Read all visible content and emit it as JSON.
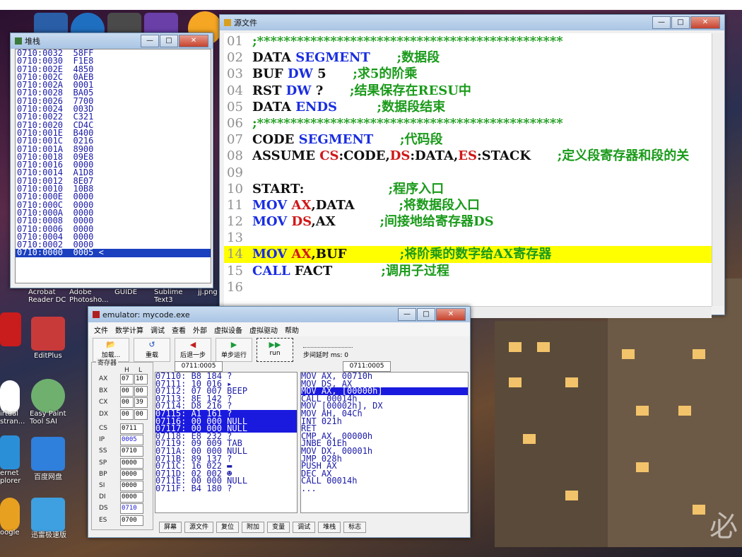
{
  "desktop": {
    "icons": [
      {
        "label": "Acrobat Reader DC",
        "lines": [
          "Acrobat",
          "Reader DC"
        ]
      },
      {
        "label": "Adobe Photoshop",
        "lines": [
          "Adobe",
          "Photosho..."
        ]
      },
      {
        "label": "GUIDE",
        "lines": [
          "GUIDE"
        ]
      },
      {
        "label": "Sublime Text3",
        "lines": [
          "Sublime",
          "Text3"
        ]
      },
      {
        "label": "jj.png",
        "lines": [
          "jj.png"
        ]
      },
      {
        "label": "EditPlus",
        "lines": [
          "EditPlus"
        ]
      },
      {
        "label": "Easy Paint Tool SAI",
        "lines": [
          "Easy Paint",
          "Tool SAI"
        ]
      },
      {
        "label": "百度网盘",
        "lines": [
          "百度网盘"
        ]
      },
      {
        "label": "迅雷极速版",
        "lines": [
          "迅雷极速版"
        ]
      },
      {
        "label": "Internet Explorer",
        "lines": [
          "ernet",
          "plorer"
        ]
      },
      {
        "label": "Google",
        "lines": [
          "oogle"
        ]
      },
      {
        "label": "Virtual",
        "lines": [
          "irtual",
          "stran..."
        ]
      }
    ],
    "watermark": "必"
  },
  "stack_window": {
    "title": "堆栈",
    "rows": [
      {
        "addr": "0710:0032",
        "val": "58FF"
      },
      {
        "addr": "0710:0030",
        "val": "F1E8"
      },
      {
        "addr": "0710:002E",
        "val": "4850"
      },
      {
        "addr": "0710:002C",
        "val": "0AEB"
      },
      {
        "addr": "0710:002A",
        "val": "0001"
      },
      {
        "addr": "0710:0028",
        "val": "BA05"
      },
      {
        "addr": "0710:0026",
        "val": "7700"
      },
      {
        "addr": "0710:0024",
        "val": "003D"
      },
      {
        "addr": "0710:0022",
        "val": "C321"
      },
      {
        "addr": "0710:0020",
        "val": "CD4C"
      },
      {
        "addr": "0710:001E",
        "val": "B400"
      },
      {
        "addr": "0710:001C",
        "val": "0216"
      },
      {
        "addr": "0710:001A",
        "val": "8900"
      },
      {
        "addr": "0710:0018",
        "val": "09E8"
      },
      {
        "addr": "0710:0016",
        "val": "0000"
      },
      {
        "addr": "0710:0014",
        "val": "A1D8"
      },
      {
        "addr": "0710:0012",
        "val": "8E07"
      },
      {
        "addr": "0710:0010",
        "val": "10B8"
      },
      {
        "addr": "0710:000E",
        "val": "0000"
      },
      {
        "addr": "0710:000C",
        "val": "0000"
      },
      {
        "addr": "0710:000A",
        "val": "0000"
      },
      {
        "addr": "0710:0008",
        "val": "0000"
      },
      {
        "addr": "0710:0006",
        "val": "0000"
      },
      {
        "addr": "0710:0004",
        "val": "0000"
      },
      {
        "addr": "0710:0002",
        "val": "0000"
      },
      {
        "addr": "0710:0000",
        "val": "0005 <",
        "selected": true
      }
    ]
  },
  "source_window": {
    "title": "源文件",
    "lines": [
      {
        "n": "01",
        "parts": [
          [
            "cmt",
            ";**********************************************"
          ]
        ]
      },
      {
        "n": "02",
        "parts": [
          [
            "txt",
            "DATA "
          ],
          [
            "kw",
            "SEGMENT"
          ],
          [
            "txt",
            "      "
          ],
          [
            "cmt",
            ";数据段"
          ]
        ]
      },
      {
        "n": "03",
        "parts": [
          [
            "txt",
            "BUF "
          ],
          [
            "kw",
            "DW"
          ],
          [
            "txt",
            " 5      "
          ],
          [
            "cmt",
            ";求5的阶乘"
          ]
        ]
      },
      {
        "n": "04",
        "parts": [
          [
            "txt",
            "RST "
          ],
          [
            "kw",
            "DW"
          ],
          [
            "txt",
            " ?      "
          ],
          [
            "cmt",
            ";结果保存在RESU中"
          ]
        ]
      },
      {
        "n": "05",
        "parts": [
          [
            "txt",
            "DATA "
          ],
          [
            "kw",
            "ENDS"
          ],
          [
            "txt",
            "         "
          ],
          [
            "cmt",
            ";数据段结束"
          ]
        ]
      },
      {
        "n": "06",
        "parts": [
          [
            "cmt",
            ";**********************************************"
          ]
        ]
      },
      {
        "n": "07",
        "parts": [
          [
            "txt",
            "CODE "
          ],
          [
            "kw",
            "SEGMENT"
          ],
          [
            "txt",
            "      "
          ],
          [
            "cmt",
            ";代码段"
          ]
        ]
      },
      {
        "n": "08",
        "parts": [
          [
            "kw",
            ""
          ],
          [
            "txt",
            "ASSUME "
          ],
          [
            "reg",
            "CS"
          ],
          [
            "txt",
            ":CODE,"
          ],
          [
            "reg",
            "DS"
          ],
          [
            "txt",
            ":DATA,"
          ],
          [
            "reg",
            "ES"
          ],
          [
            "txt",
            ":STACK      "
          ],
          [
            "cmt",
            ";定义段寄存器和段的关"
          ]
        ]
      },
      {
        "n": "09",
        "parts": []
      },
      {
        "n": "10",
        "parts": [
          [
            "txt",
            "START:                   "
          ],
          [
            "cmt",
            ";程序入口"
          ]
        ]
      },
      {
        "n": "11",
        "parts": [
          [
            "kw",
            "MOV "
          ],
          [
            "reg",
            "AX"
          ],
          [
            "txt",
            ",DATA          "
          ],
          [
            "cmt",
            ";将数据段入口"
          ]
        ]
      },
      {
        "n": "12",
        "parts": [
          [
            "kw",
            "MOV "
          ],
          [
            "reg",
            "DS"
          ],
          [
            "txt",
            ",AX          "
          ],
          [
            "cmt",
            ";间接地给寄存器DS"
          ]
        ]
      },
      {
        "n": "13",
        "parts": []
      },
      {
        "n": "14",
        "hl": true,
        "parts": [
          [
            "kw",
            "MOV "
          ],
          [
            "reg",
            "AX"
          ],
          [
            "txt",
            ",BUF            "
          ],
          [
            "cmt",
            ";将阶乘的数字给AX寄存器"
          ]
        ]
      },
      {
        "n": "15",
        "parts": [
          [
            "kw",
            "CALL "
          ],
          [
            "txt",
            "FACT           "
          ],
          [
            "cmt",
            ";调用子过程"
          ]
        ]
      },
      {
        "n": "16",
        "parts": []
      }
    ]
  },
  "emulator": {
    "title": "emulator: mycode.exe",
    "menu": [
      "文件",
      "数学计算",
      "调试",
      "查看",
      "外部",
      "虚拟设备",
      "虚拟驱动",
      "帮助"
    ],
    "toolbar": [
      {
        "label": "加载...",
        "icon": "folder-icon"
      },
      {
        "label": "重载",
        "icon": "reload-icon"
      },
      {
        "label": "后退一步",
        "icon": "step-back-icon"
      },
      {
        "label": "单步运行",
        "icon": "step-forward-icon"
      },
      {
        "label": "run",
        "icon": "run-icon"
      }
    ],
    "step_delay_label": "步间延时 ms: 0",
    "registers_label": "寄存器",
    "hl_headers": [
      "H",
      "L"
    ],
    "regs_hl": [
      {
        "name": "AX",
        "h": "07",
        "l": "10"
      },
      {
        "name": "BX",
        "h": "00",
        "l": "00"
      },
      {
        "name": "CX",
        "h": "00",
        "l": "39"
      },
      {
        "name": "DX",
        "h": "00",
        "l": "00"
      }
    ],
    "regs": [
      {
        "name": "CS",
        "val": "0711"
      },
      {
        "name": "IP",
        "val": "0005"
      },
      {
        "name": "SS",
        "val": "0710"
      },
      {
        "name": "SP",
        "val": "0000"
      },
      {
        "name": "BP",
        "val": "0000"
      },
      {
        "name": "SI",
        "val": "0000"
      },
      {
        "name": "DI",
        "val": "0000"
      },
      {
        "name": "DS",
        "val": "0710"
      },
      {
        "name": "ES",
        "val": "0700"
      }
    ],
    "addr_left": "0711:0005",
    "addr_right": "0711:0005",
    "memory": [
      {
        "text": "07110: B8 184 ?"
      },
      {
        "text": "07111: 10 016 ▸"
      },
      {
        "text": "07112: 07 007 BEEP"
      },
      {
        "text": "07113: 8E 142 ?"
      },
      {
        "text": "07114: D8 216 ?"
      },
      {
        "text": "07115: A1 161 ?",
        "selected": true
      },
      {
        "text": "07116: 00 000 NULL",
        "selected": true
      },
      {
        "text": "07117: 00 000 NULL",
        "selected": true
      },
      {
        "text": "07118: E8 232 ?"
      },
      {
        "text": "07119: 09 009 TAB"
      },
      {
        "text": "0711A: 00 000 NULL"
      },
      {
        "text": "0711B: 89 137 ?"
      },
      {
        "text": "0711C: 16 022 ▬"
      },
      {
        "text": "0711D: 02 002 ☻"
      },
      {
        "text": "0711E: 00 000 NULL"
      },
      {
        "text": "0711F: B4 180 ?"
      }
    ],
    "disassembly": [
      {
        "text": "MOV AX, 00710h"
      },
      {
        "text": "MOV DS, AX"
      },
      {
        "text": "MOV AX, [00000h]",
        "selected": true
      },
      {
        "text": "CALL 00014h"
      },
      {
        "text": "MOV [00002h], DX"
      },
      {
        "text": "MOV AH, 04Ch"
      },
      {
        "text": "INT 021h"
      },
      {
        "text": "RET"
      },
      {
        "text": "CMP AX, 00000h"
      },
      {
        "text": "JNBE 01Eh"
      },
      {
        "text": "MOV DX, 00001h"
      },
      {
        "text": "JMP 028h"
      },
      {
        "text": "PUSH AX"
      },
      {
        "text": "DEC AX"
      },
      {
        "text": "CALL 00014h"
      },
      {
        "text": "..."
      }
    ],
    "bottom_buttons": [
      "屏幕",
      "源文件",
      "复位",
      "附加",
      "变量",
      "调试",
      "堆栈",
      "标志"
    ]
  }
}
